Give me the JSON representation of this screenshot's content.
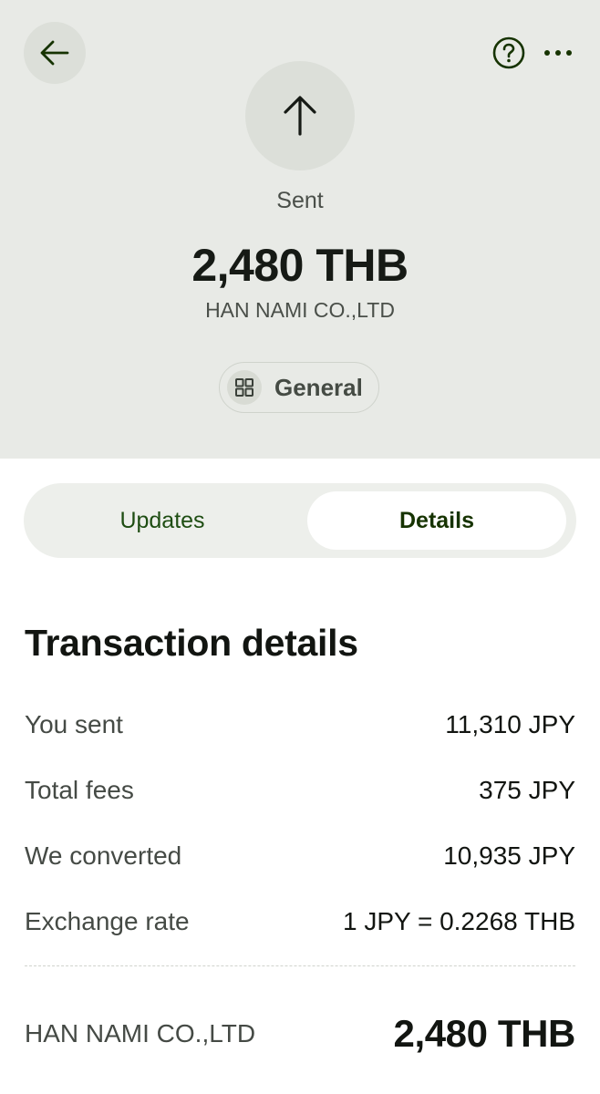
{
  "header": {
    "status": "Sent",
    "amount": "2,480 THB",
    "recipient": "HAN NAMI CO.,LTD",
    "category": "General",
    "icons": {
      "back": "arrow-left-icon",
      "help": "question-circle-icon",
      "more": "ellipsis-icon",
      "status": "arrow-up-icon",
      "category": "grid-icon"
    }
  },
  "tabs": [
    {
      "label": "Updates",
      "selected": false
    },
    {
      "label": "Details",
      "selected": true
    }
  ],
  "details": {
    "title": "Transaction details",
    "rows": [
      {
        "label": "You sent",
        "value": "11,310 JPY"
      },
      {
        "label": "Total fees",
        "value": "375 JPY"
      },
      {
        "label": "We converted",
        "value": "10,935 JPY"
      },
      {
        "label": "Exchange rate",
        "value": "1 JPY = 0.2268 THB"
      }
    ],
    "total": {
      "label": "HAN NAMI CO.,LTD",
      "value": "2,480 THB"
    }
  },
  "colors": {
    "header_bg": "#e8eae6",
    "accent": "#163300",
    "text": "#121511"
  }
}
